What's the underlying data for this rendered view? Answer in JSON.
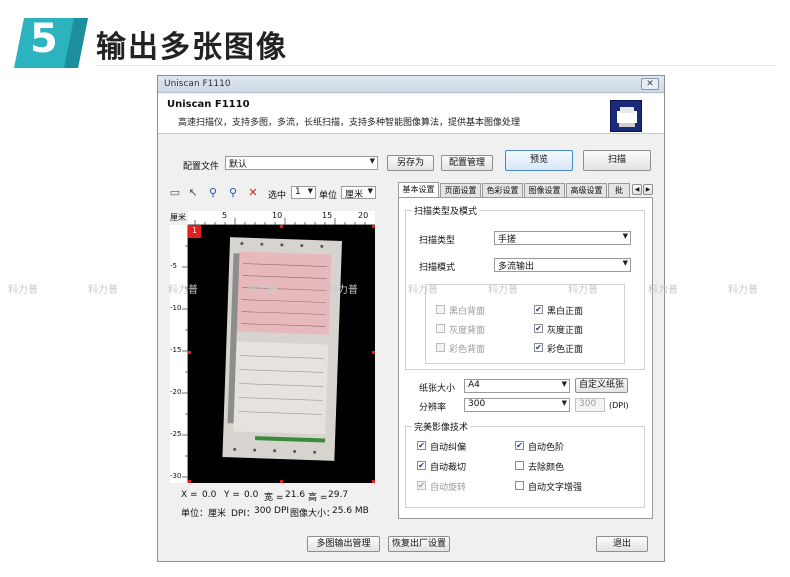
{
  "header": {
    "step_number": "5",
    "title": "输出多张图像"
  },
  "colors": {
    "accent_teal": "#2bb3c0",
    "scanner_icon": "#1a2a78",
    "preview_bg": "#000000",
    "marker_red": "#e02020"
  },
  "window": {
    "title": "Uniscan F1110",
    "close_glyph": "✕"
  },
  "app_info": {
    "name": "Uniscan F1110",
    "description": "高速扫描仪，支持多图，多流，长纸扫描，支持多种智能图像算法，提供基本图像处理"
  },
  "config": {
    "label": "配置文件",
    "value": "默认",
    "save_as": "另存为",
    "manage": "配置管理",
    "preview": "预览",
    "scan": "扫描"
  },
  "toolbar": {
    "select_label": "选中",
    "select_value": "1",
    "unit_label": "单位",
    "unit_value": "厘米",
    "icons": [
      "rectangle-icon",
      "pointer-icon",
      "zoom-in-icon",
      "zoom-out-icon",
      "delete-icon"
    ]
  },
  "ruler": {
    "unit": "厘米",
    "h_ticks": [
      "5",
      "10",
      "15",
      "20"
    ],
    "v_ticks": [
      "-5",
      "-10",
      "-15",
      "-20",
      "-25",
      "-30"
    ]
  },
  "preview": {
    "page_number": "1"
  },
  "status": {
    "x_label": "X =",
    "x_value": "0.0",
    "y_label": "Y =",
    "y_value": "0.0",
    "w_label": "宽 =",
    "w_value": "21.6",
    "h_label": "高 =",
    "h_value": "29.7",
    "unit_label": "单位：",
    "unit_value": "厘米",
    "dpi_label": "DPI：",
    "dpi_value": "300 DPI",
    "size_label": "图像大小：",
    "size_value": "25.6 MB"
  },
  "tabs": [
    "基本设置",
    "页面设置",
    "色彩设置",
    "图像设置",
    "高级设置",
    "批"
  ],
  "scan_type_group": {
    "title": "扫描类型及模式",
    "type_label": "扫描类型",
    "type_value": "手搓",
    "mode_label": "扫描模式",
    "mode_value": "多流输出",
    "options": [
      {
        "label": "黑白背面",
        "checked": false,
        "enabled": false
      },
      {
        "label": "黑白正面",
        "checked": true,
        "enabled": true
      },
      {
        "label": "灰度背面",
        "checked": false,
        "enabled": false
      },
      {
        "label": "灰度正面",
        "checked": true,
        "enabled": true
      },
      {
        "label": "彩色背面",
        "checked": false,
        "enabled": false
      },
      {
        "label": "彩色正面",
        "checked": true,
        "enabled": true
      }
    ]
  },
  "paper": {
    "size_label": "纸张大小",
    "size_value": "A4",
    "custom_button": "自定义纸张",
    "dpi_label": "分辨率",
    "dpi_value": "300",
    "dpi_input": "300",
    "dpi_unit": "(DPI)"
  },
  "enhance_group": {
    "title": "完美影像技术",
    "options": [
      {
        "label": "自动纠偏",
        "checked": true,
        "enabled": true
      },
      {
        "label": "自动色阶",
        "checked": true,
        "enabled": true
      },
      {
        "label": "自动裁切",
        "checked": true,
        "enabled": true
      },
      {
        "label": "去除颜色",
        "checked": false,
        "enabled": true
      },
      {
        "label": "自动旋转",
        "checked": true,
        "enabled": false
      },
      {
        "label": "自动文字增强",
        "checked": false,
        "enabled": true
      }
    ]
  },
  "footer": {
    "multi_output": "多图输出管理",
    "restore": "恢复出厂设置",
    "exit": "退出"
  },
  "watermark": {
    "text": "科力普"
  }
}
